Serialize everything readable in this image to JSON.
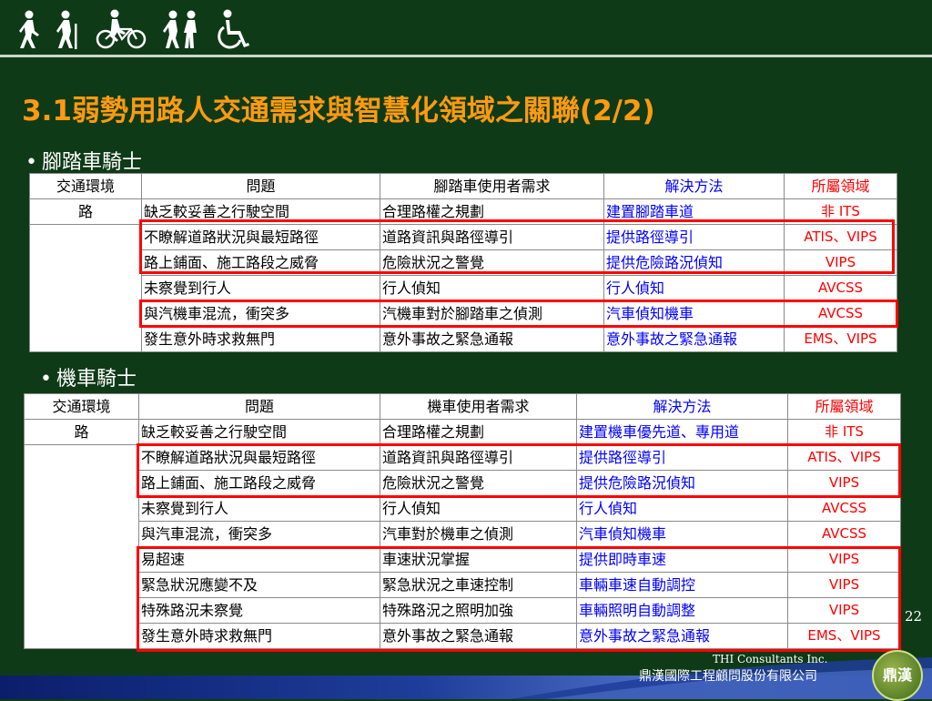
{
  "header": {
    "icons": [
      "walking-person-icon",
      "hiker-icon",
      "cyclist-icon",
      "walking-pair-icon",
      "wheelchair-icon"
    ]
  },
  "title": "3.1弱勢用路人交通需求與智慧化領域之關聯(2/2)",
  "sections": {
    "bicycle": "腳踏車騎士",
    "motorcycle": "機車騎士"
  },
  "bicycle_table": {
    "headers": [
      "交通環境",
      "問題",
      "腳踏車使用者需求",
      "解決方法",
      "所屬領域"
    ],
    "env": "路",
    "rows": [
      [
        "缺乏較妥善之行駛空間",
        "合理路權之規劃",
        "建置腳踏車道",
        "非 ITS"
      ],
      [
        "不瞭解道路狀況與最短路徑",
        "道路資訊與路徑導引",
        "提供路徑導引",
        "ATIS、VIPS"
      ],
      [
        "路上鋪面、施工路段之威脅",
        "危險狀況之警覺",
        "提供危險路況偵知",
        "VIPS"
      ],
      [
        "未察覺到行人",
        "行人偵知",
        "行人偵知",
        "AVCSS"
      ],
      [
        "與汽機車混流，衝突多",
        "汽機車對於腳踏車之偵測",
        "汽車偵知機車",
        "AVCSS"
      ],
      [
        "發生意外時求救無門",
        "意外事故之緊急通報",
        "意外事故之緊急通報",
        "EMS、VIPS"
      ]
    ]
  },
  "motorcycle_table": {
    "headers": [
      "交通環境",
      "問題",
      "機車使用者需求",
      "解決方法",
      "所屬領域"
    ],
    "env": "路",
    "rows": [
      [
        "缺乏較妥善之行駛空間",
        "合理路權之規劃",
        "建置機車優先道、專用道",
        "非 ITS"
      ],
      [
        "不瞭解道路狀況與最短路徑",
        "道路資訊與路徑導引",
        "提供路徑導引",
        "ATIS、VIPS"
      ],
      [
        "路上鋪面、施工路段之威脅",
        "危險狀況之警覺",
        "提供危險路況偵知",
        "VIPS"
      ],
      [
        "未察覺到行人",
        "行人偵知",
        "行人偵知",
        "AVCSS"
      ],
      [
        "與汽車混流，衝突多",
        "汽車對於機車之偵測",
        "汽車偵知機車",
        "AVCSS"
      ],
      [
        "易超速",
        "車速狀況掌握",
        "提供即時車速",
        "VIPS"
      ],
      [
        "緊急狀況應變不及",
        "緊急狀況之車速控制",
        "車輛車速自動調控",
        "VIPS"
      ],
      [
        "特殊路況未察覺",
        "特殊路況之照明加強",
        "車輛照明自動調整",
        "VIPS"
      ],
      [
        "發生意外時求救無門",
        "意外事故之緊急通報",
        "意外事故之緊急通報",
        "EMS、VIPS"
      ]
    ]
  },
  "page_number": "22",
  "footer": {
    "company_en": "THI Consultants Inc.",
    "company_zh": "鼎漢國際工程顧問股份有限公司",
    "logo_text": "鼎漢"
  },
  "colors": {
    "background": "#0f3a17",
    "title": "#ff9a10",
    "highlight": "#ff0000",
    "solution_text": "#0000ff",
    "domain_text": "#ff0000"
  }
}
